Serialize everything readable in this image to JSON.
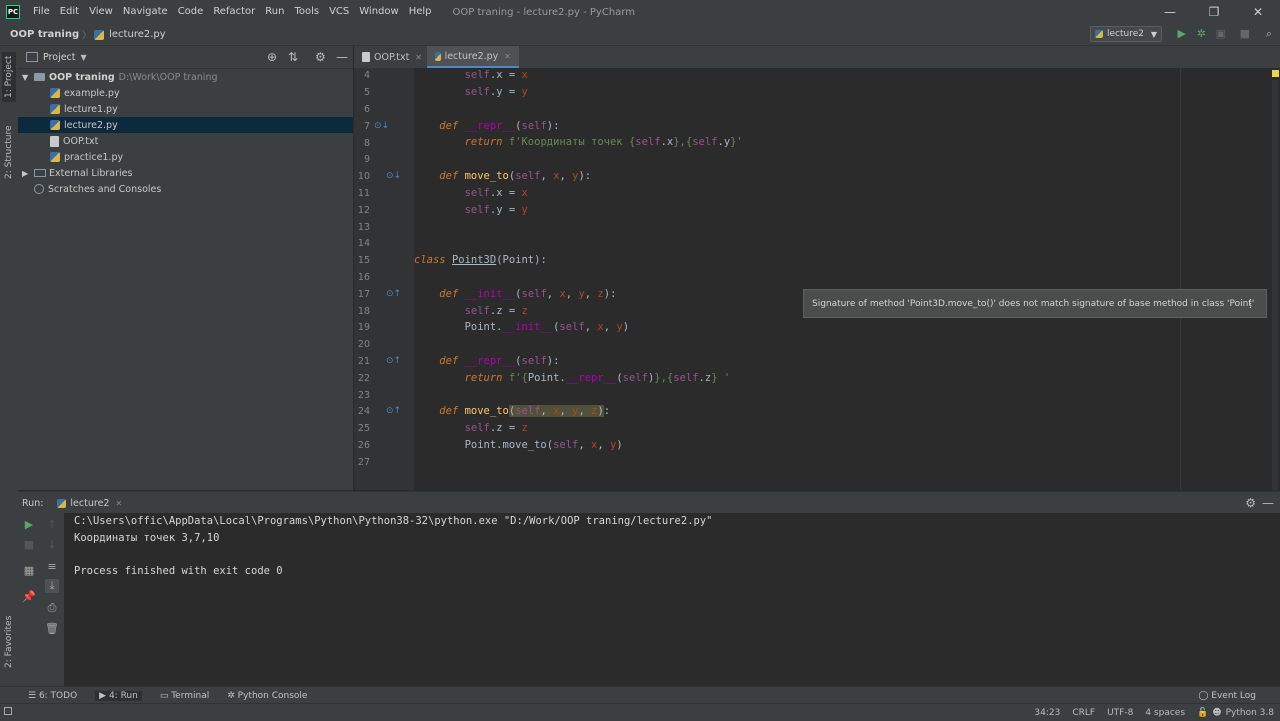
{
  "app": {
    "icon_text": "PC",
    "window_title": "OOP traning - lecture2.py - PyCharm",
    "menu": [
      "File",
      "Edit",
      "View",
      "Navigate",
      "Code",
      "Refactor",
      "Run",
      "Tools",
      "VCS",
      "Window",
      "Help"
    ]
  },
  "navbar": {
    "crumbs": [
      "OOP traning",
      "lecture2.py"
    ],
    "run_config": "lecture2"
  },
  "left_stripe": {
    "project_tab": "1: Project",
    "structure_tab": "2: Structure",
    "favorites_tab": "2: Favorites"
  },
  "project": {
    "title": "Project",
    "tree": [
      {
        "label": "OOP traning",
        "extra": "D:\\Work\\OOP traning",
        "type": "folder"
      },
      {
        "label": "example.py",
        "type": "py"
      },
      {
        "label": "lecture1.py",
        "type": "py"
      },
      {
        "label": "lecture2.py",
        "type": "py",
        "selected": true
      },
      {
        "label": "OOP.txt",
        "type": "txt"
      },
      {
        "label": "practice1.py",
        "type": "py"
      },
      {
        "label": "External Libraries",
        "type": "lib"
      },
      {
        "label": "Scratches and Consoles",
        "type": "scratch"
      }
    ]
  },
  "editor": {
    "tabs": [
      {
        "label": "OOP.txt"
      },
      {
        "label": "lecture2.py",
        "active": true
      }
    ],
    "line_numbers": [
      "4",
      "5",
      "6",
      "7",
      "8",
      "9",
      "10",
      "11",
      "12",
      "13",
      "14",
      "15",
      "16",
      "17",
      "18",
      "19",
      "20",
      "21",
      "22",
      "23",
      "24",
      "25",
      "26",
      "27"
    ],
    "tooltip": "Signature of method 'Point3D.move_to()' does not match signature of base method in class 'Point'"
  },
  "run": {
    "label": "Run:",
    "tab": "lecture2",
    "output": [
      "C:\\Users\\offic\\AppData\\Local\\Programs\\Python\\Python38-32\\python.exe \"D:/Work/OOP traning/lecture2.py\"",
      "Координаты точек 3,7,10",
      "",
      "Process finished with exit code 0"
    ]
  },
  "bottom_tools": [
    "6: TODO",
    "4: Run",
    "Terminal",
    "Python Console"
  ],
  "event_log": "Event Log",
  "status": [
    "34:23",
    "CRLF",
    "UTF-8",
    "4 spaces",
    "Python 3.8"
  ]
}
